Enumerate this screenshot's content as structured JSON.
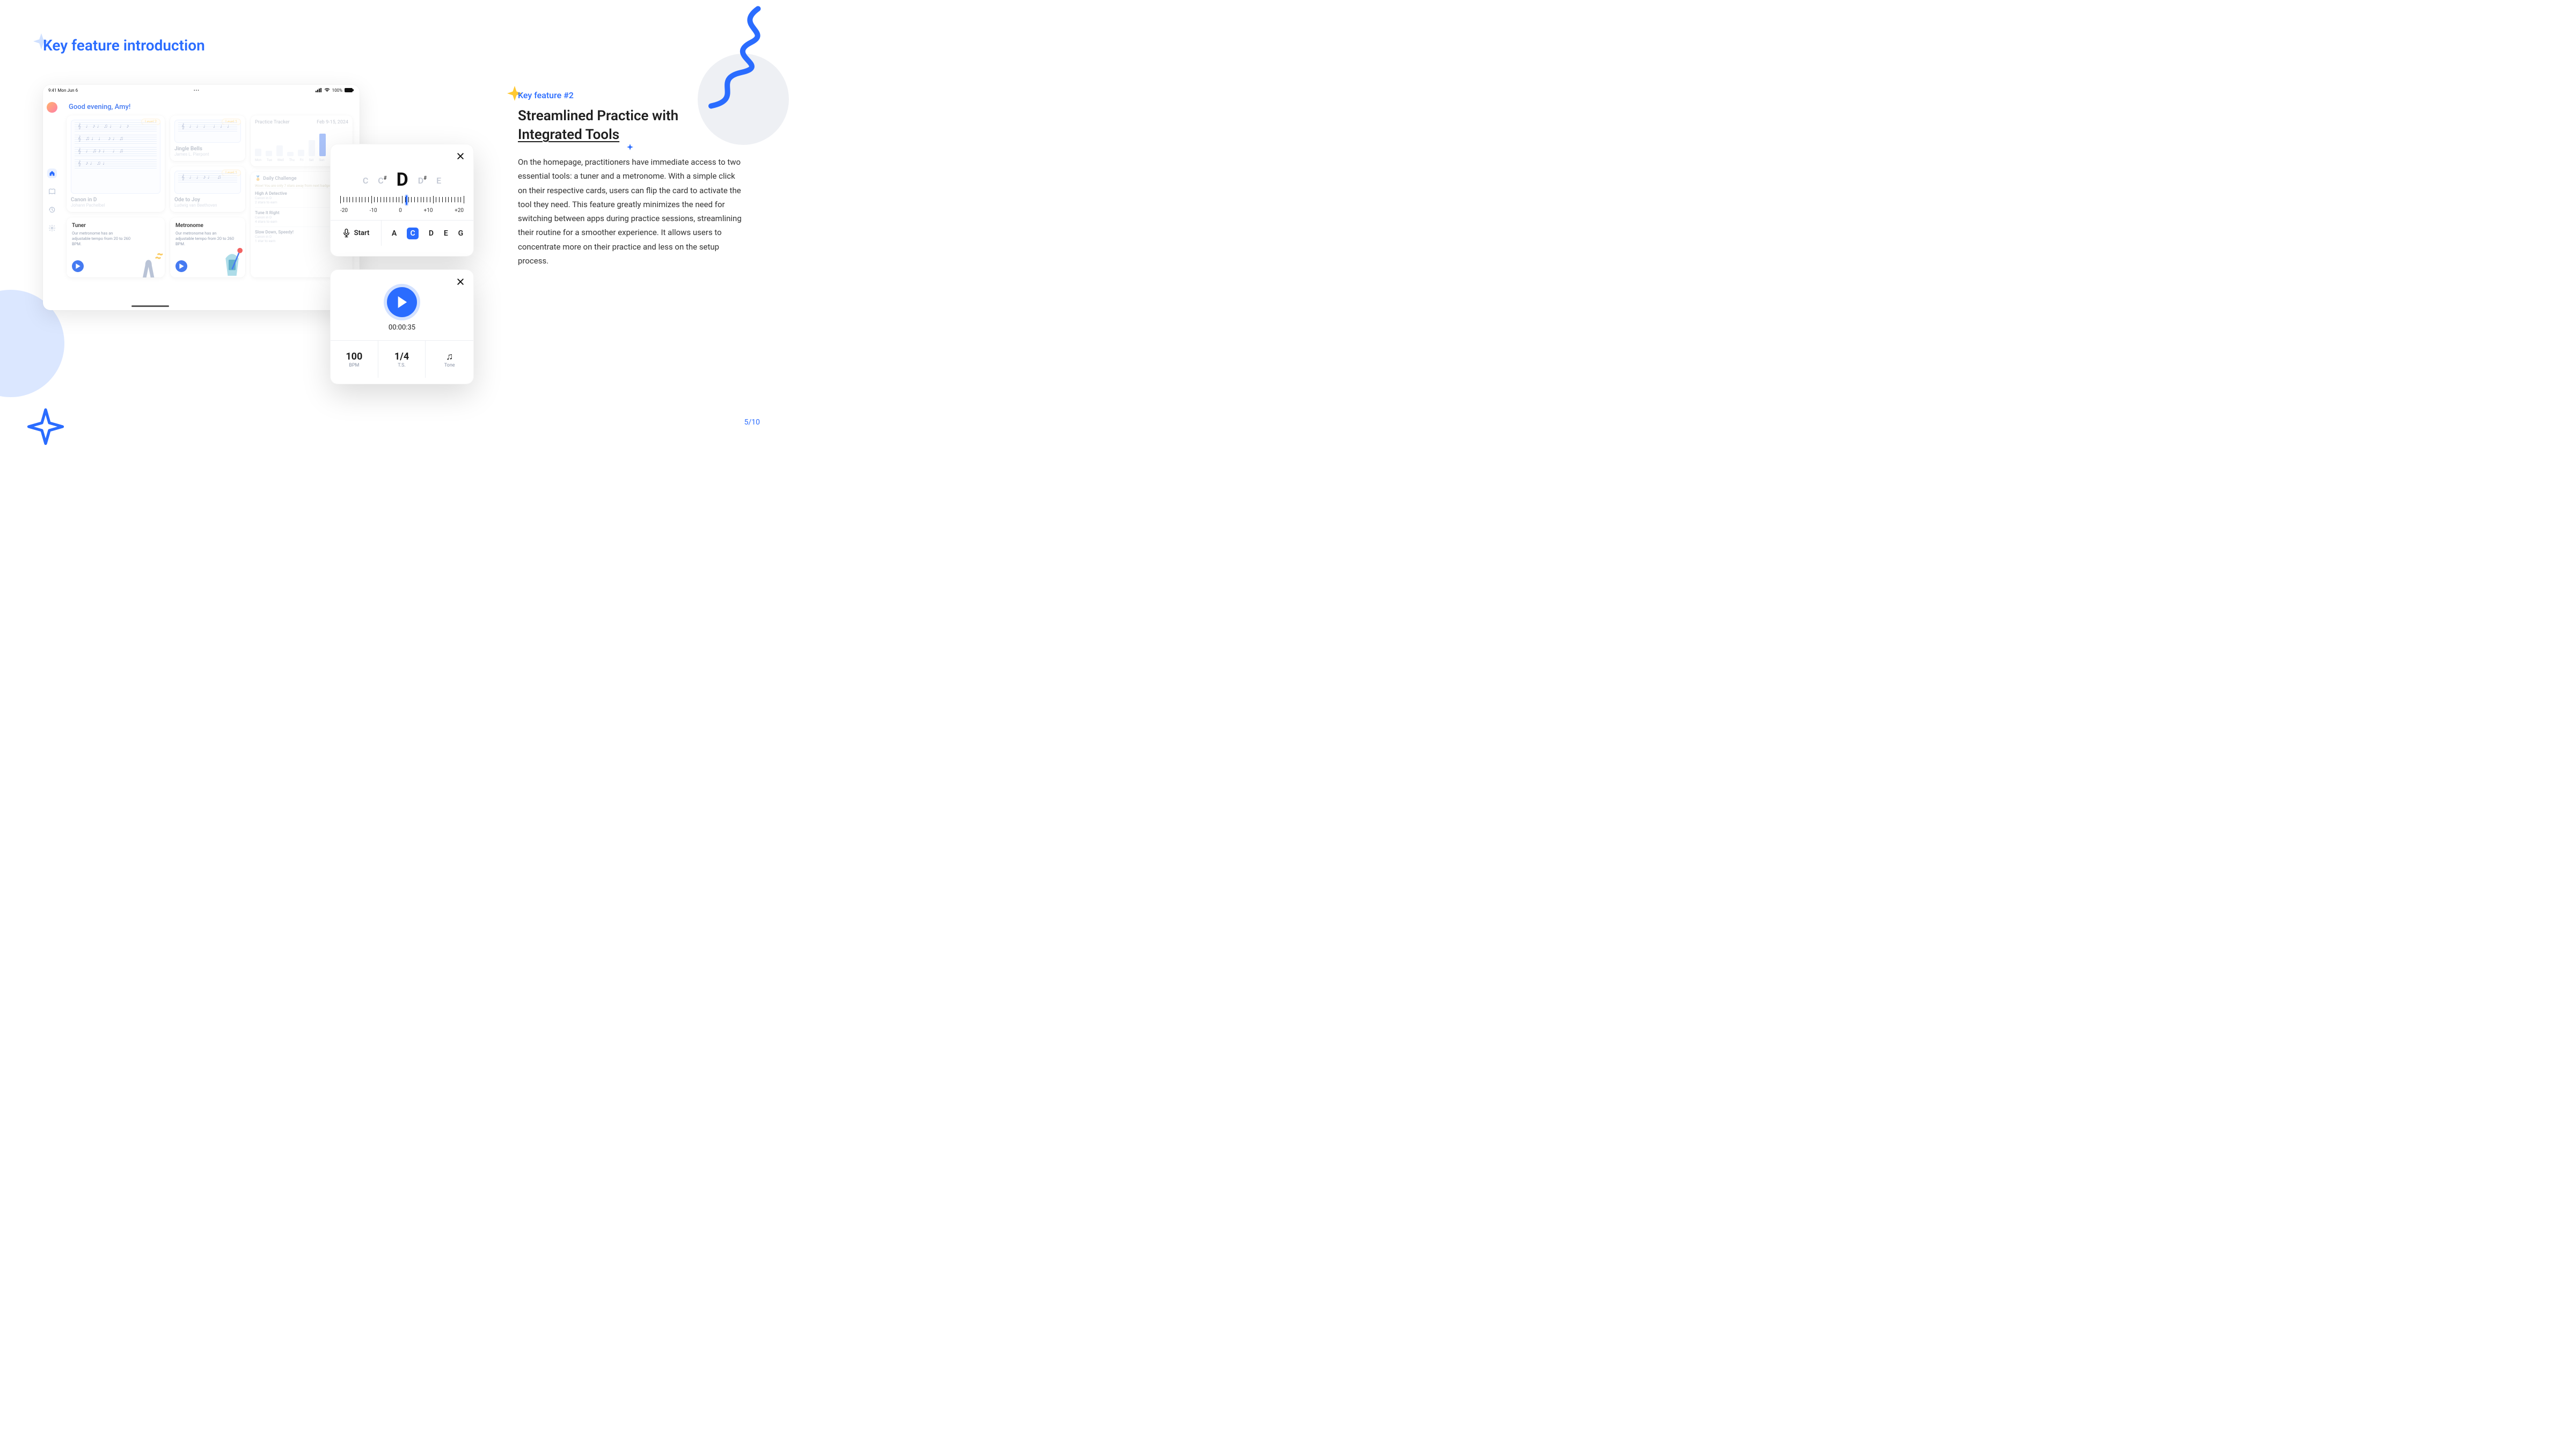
{
  "page": {
    "title": "Key feature introduction",
    "page_number": "5/10"
  },
  "right": {
    "tag": "Key feature #2",
    "headline_line1": "Streamlined Practice with",
    "headline_line2": "Integrated Tools",
    "body": "On the homepage, practitioners have immediate access to two essential tools: a tuner and a metronome. With a simple click on their respective cards, users can flip the card to activate the tool they need. This feature greatly minimizes the need for switching between apps during practice sessions, streamlining their routine for a smoother experience. It allows users to concentrate more on their practice and less on the setup process."
  },
  "tablet": {
    "status_left": "9:41  Mon Jun 6",
    "status_mid": "•••",
    "status_right": "100%",
    "greeting": "Good evening, Amy!",
    "song1": {
      "title": "Canon in D",
      "sub": "Johann Pachelbel",
      "level": "Level 2"
    },
    "song2": {
      "title": "Jingle Bells",
      "sub": "James L. Pierpont",
      "level": "Level 1"
    },
    "song3": {
      "title": "Ode to Joy",
      "sub": "Ludwig van Beethoven",
      "level": "Level 1"
    },
    "tracker": {
      "title": "Practice Tracker",
      "date": "Feb 9-15, 2024",
      "days": [
        "Mon",
        "Tue",
        "Wed",
        "Thu",
        "Fri",
        "Sat",
        "Sun"
      ]
    },
    "tuner_card": {
      "title": "Tuner",
      "desc": "Our metronome has an adjustable tempo from 20 to 260 BPM."
    },
    "metro_card": {
      "title": "Metronome",
      "desc": "Our metronome has an adjustable tempo from 20 to 260 BPM."
    },
    "challenge": {
      "title": "Daily Challenge",
      "hint": "Wow! You are only 7 stars away from next badge!",
      "rows": [
        {
          "t": "High A Detective",
          "s": "Canon in D",
          "n": "2 stars to earn"
        },
        {
          "t": "Tune It Right",
          "s": "Canon in D",
          "n": "4 stars to earn"
        },
        {
          "t": "Slow Down, Speedy!",
          "s": "Canon in D",
          "n": "1 star to earn"
        }
      ]
    }
  },
  "tuner_popup": {
    "notes": {
      "far_l": "C",
      "near_l": "C",
      "mid": "D",
      "near_r": "D",
      "far_r": "E"
    },
    "scale": [
      "-20",
      "-10",
      "0",
      "+10",
      "+20"
    ],
    "start": "Start",
    "letters": [
      "A",
      "C",
      "D",
      "E",
      "G"
    ],
    "selected_letter": "C"
  },
  "metro_popup": {
    "time": "00:00:35",
    "bpm_val": "100",
    "bpm_lbl": "BPM",
    "ts_val": "1/4",
    "ts_lbl": "T.S.",
    "tone_val": "♫",
    "tone_lbl": "Tone"
  }
}
